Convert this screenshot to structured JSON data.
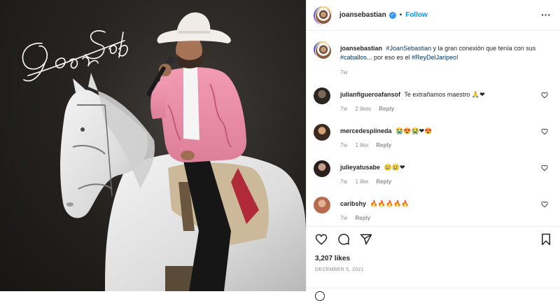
{
  "header": {
    "username": "joansebastian",
    "follow_label": "Follow",
    "separator": "•",
    "more_label": "···"
  },
  "media": {
    "signature_text": "Joan Sebastian"
  },
  "caption": {
    "username": "joansebastian",
    "hashtag1": "#JoanSebastian",
    "text1": " y la gran conexión que tenía con sus ",
    "hashtag2": "#caballos",
    "text2": "... por eso es el ",
    "hashtag3": "#ReyDelJaripeo",
    "text3": "!",
    "time": "7w"
  },
  "comments": [
    {
      "username": "julianfigueroafansof",
      "text": "Te extrañamos maestro",
      "emoji": "🙏❤",
      "time": "7w",
      "likes": "2 likes",
      "reply": "Reply"
    },
    {
      "username": "mercedespiineda",
      "text": "",
      "emoji": "😭😍😭❤😍",
      "time": "7w",
      "likes": "1 like",
      "reply": "Reply"
    },
    {
      "username": "julieyatusabe",
      "text": "",
      "emoji": "😢😢❤",
      "time": "7w",
      "likes": "1 like",
      "reply": "Reply"
    },
    {
      "username": "caribshy",
      "text": "",
      "emoji": "🔥🔥🔥🔥🔥",
      "time": "7w",
      "likes": "",
      "reply": "Reply"
    }
  ],
  "actions": {
    "likes": "3,207 likes",
    "date": "DECEMBER 5, 2021"
  },
  "colors": {
    "accent": "#0095f6",
    "verified": "#3897f0",
    "hashtag": "#00376b",
    "muted": "#8e8e8e",
    "jacket": "#e98fa8"
  }
}
